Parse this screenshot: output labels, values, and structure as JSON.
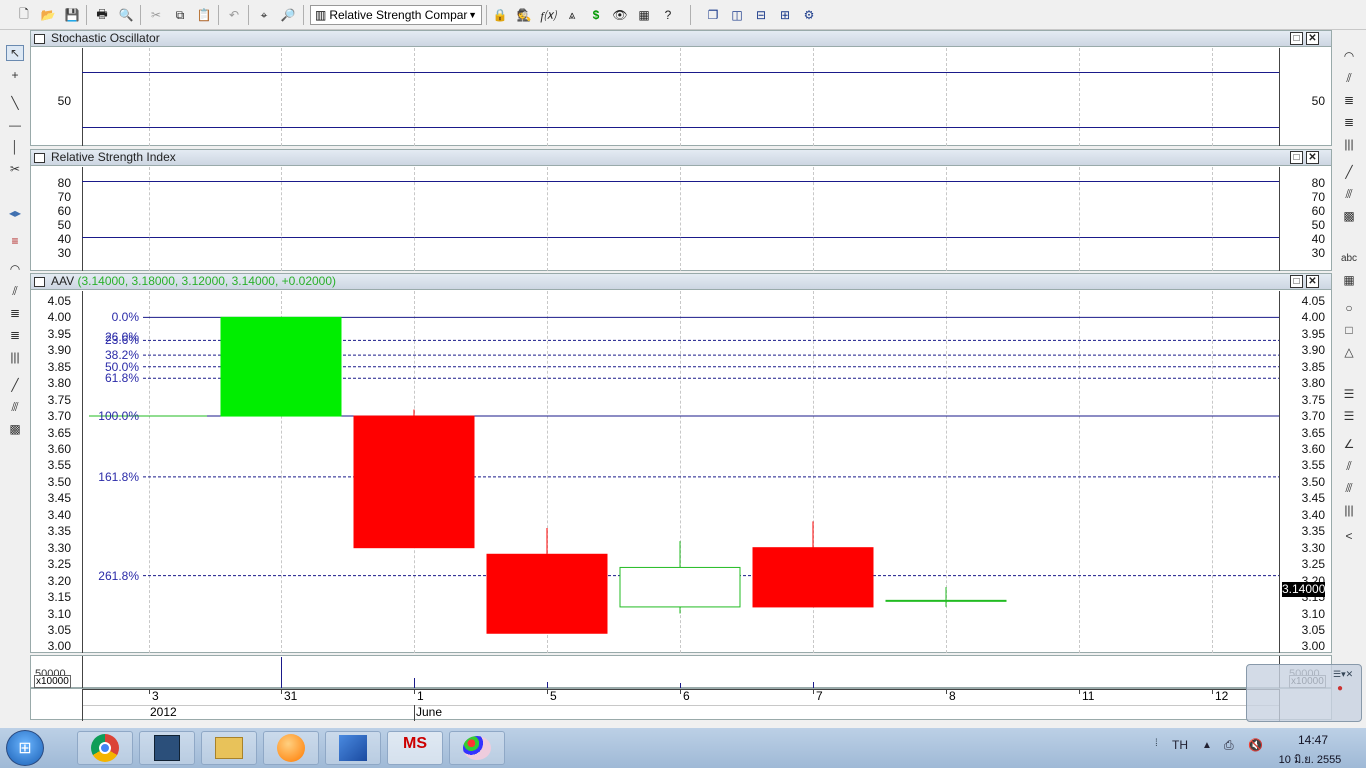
{
  "toolbar": {
    "indicator_select": "Relative Strength Comparati",
    "icons": [
      "new-icon",
      "open-icon",
      "save-icon",
      "print-icon",
      "print-preview-icon",
      "cut-icon",
      "copy-icon",
      "paste-icon",
      "undo-icon",
      "crosshair-icon",
      "zoom-icon",
      "indicator-icon",
      "wizard-icon",
      "function-icon",
      "chart-icon",
      "dollar-icon",
      "binoculars-icon",
      "grid-icon",
      "help-icon",
      "windows-icon",
      "tile-vertical-icon",
      "tile-horizontal-icon",
      "tile-grid-icon",
      "settings-icon"
    ]
  },
  "panels": {
    "stochastic": {
      "title": "Stochastic Oscillator",
      "left_label": "50",
      "right_label": "50"
    },
    "rsi": {
      "title": "Relative Strength Index",
      "labels": [
        "80",
        "70",
        "60",
        "50",
        "40",
        "30"
      ]
    },
    "price": {
      "title": "AAV",
      "ohlc": "(3.14000, 3.18000, 3.12000, 3.14000, +0.02000)",
      "y_labels": [
        "4.05",
        "4.00",
        "3.95",
        "3.90",
        "3.85",
        "3.80",
        "3.75",
        "3.70",
        "3.65",
        "3.60",
        "3.55",
        "3.50",
        "3.45",
        "3.40",
        "3.35",
        "3.30",
        "3.25",
        "3.20",
        "3.15",
        "3.10",
        "3.05",
        "3.00"
      ],
      "current_price": "3.14000",
      "fib_labels": [
        "0.0%",
        "23.6%",
        "38.2%",
        "50.0%",
        "61.8%",
        "100.0%",
        "161.8%",
        "261.8%"
      ],
      "fib_overlap_label": "26.0%"
    },
    "volume": {
      "label": "50000",
      "multiplier": "x10000"
    }
  },
  "axis": {
    "days": [
      "3",
      "31",
      "1",
      "5",
      "6",
      "7",
      "8",
      "11",
      "12"
    ],
    "months": [
      "2012",
      "June"
    ]
  },
  "chart_data": {
    "type": "candlestick",
    "title": "AAV",
    "categories": [
      "May 31",
      "Jun 1",
      "Jun 5",
      "Jun 6",
      "Jun 7",
      "Jun 8"
    ],
    "series": [
      {
        "name": "AAV",
        "ohlc": [
          {
            "x": "May 31",
            "open": 3.7,
            "high": 4.0,
            "low": 3.7,
            "close": 4.0
          },
          {
            "x": "Jun 1",
            "open": 3.7,
            "high": 3.72,
            "low": 3.3,
            "close": 3.3
          },
          {
            "x": "Jun 5",
            "open": 3.28,
            "high": 3.36,
            "low": 3.04,
            "close": 3.04
          },
          {
            "x": "Jun 6",
            "open": 3.12,
            "high": 3.32,
            "low": 3.1,
            "close": 3.24
          },
          {
            "x": "Jun 7",
            "open": 3.3,
            "high": 3.38,
            "low": 3.12,
            "close": 3.12
          },
          {
            "x": "Jun 8",
            "open": 3.14,
            "high": 3.18,
            "low": 3.12,
            "close": 3.14
          }
        ]
      }
    ],
    "fibonacci": [
      {
        "label": "0.0%",
        "value": 4.0
      },
      {
        "label": "23.6%",
        "value": 3.93
      },
      {
        "label": "38.2%",
        "value": 3.885
      },
      {
        "label": "50.0%",
        "value": 3.85
      },
      {
        "label": "61.8%",
        "value": 3.815
      },
      {
        "label": "100.0%",
        "value": 3.7
      },
      {
        "label": "161.8%",
        "value": 3.515
      },
      {
        "label": "261.8%",
        "value": 3.215
      }
    ],
    "ylim": [
      2.98,
      4.08
    ],
    "colors": {
      "up": "#00ee00",
      "down": "#ff0000",
      "hollow_up": "#22bb22",
      "fib": "#1a1a8a"
    }
  },
  "taskbar": {
    "lang": "TH",
    "time": "14:47",
    "date": "10 มิ.ย. 2555"
  }
}
